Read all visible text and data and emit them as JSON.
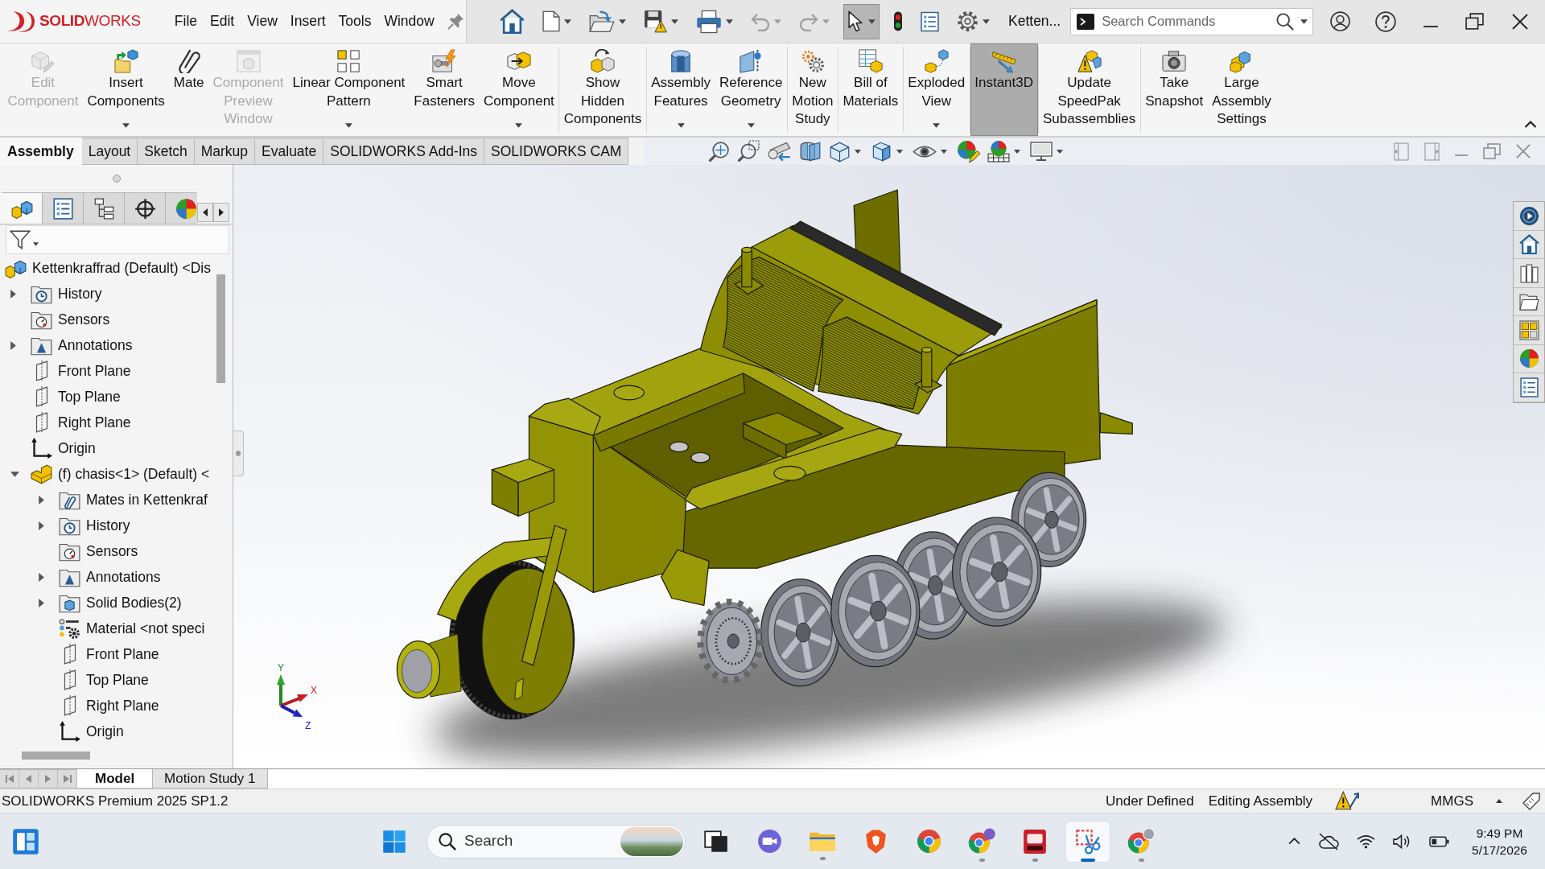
{
  "title_bar": {
    "logo": "**SOLID**WORKS",
    "menus": [
      "File",
      "Edit",
      "View",
      "Insert",
      "Tools",
      "Window"
    ],
    "quick_access": [
      {
        "kind": "home",
        "dropdown": false,
        "disabled": false,
        "selected": false
      },
      {
        "kind": "new",
        "dropdown": true,
        "disabled": false,
        "selected": false
      },
      {
        "kind": "open",
        "dropdown": true,
        "disabled": false,
        "selected": false
      },
      {
        "kind": "save",
        "dropdown": true,
        "disabled": false,
        "selected": false
      },
      {
        "kind": "print",
        "dropdown": true,
        "disabled": false,
        "selected": false
      },
      {
        "kind": "undo",
        "dropdown": true,
        "disabled": true,
        "selected": false
      },
      {
        "kind": "redo",
        "dropdown": true,
        "disabled": true,
        "selected": false
      },
      {
        "kind": "select",
        "dropdown": true,
        "disabled": false,
        "selected": true
      },
      {
        "kind": "rebuild",
        "dropdown": false,
        "disabled": false,
        "selected": false
      },
      {
        "kind": "file-properties",
        "dropdown": false,
        "disabled": false,
        "selected": false
      },
      {
        "kind": "options",
        "dropdown": true,
        "disabled": false,
        "selected": false
      }
    ],
    "document_title": "Ketten...",
    "search": {
      "placeholder": "Search Commands"
    }
  },
  "ribbon": {
    "groups": [
      {
        "items": [
          {
            "kind": "edit-component",
            "lines": [
              "Edit",
              "Component"
            ],
            "disabled": true,
            "dropdown": false,
            "on": false
          },
          {
            "kind": "insert-components",
            "lines": [
              "Insert",
              "Components"
            ],
            "disabled": false,
            "dropdown": true,
            "on": false
          },
          {
            "kind": "mate",
            "lines": [
              "Mate"
            ],
            "disabled": false,
            "dropdown": false,
            "on": false
          },
          {
            "kind": "preview-window",
            "lines": [
              "Component",
              "Preview",
              "Window"
            ],
            "disabled": true,
            "dropdown": false,
            "on": false
          },
          {
            "kind": "linear-pattern",
            "lines": [
              "Linear Component",
              "Pattern"
            ],
            "disabled": false,
            "dropdown": true,
            "on": false
          },
          {
            "kind": "smart-fasteners",
            "lines": [
              "Smart",
              "Fasteners"
            ],
            "disabled": false,
            "dropdown": false,
            "on": false
          },
          {
            "kind": "move-component",
            "lines": [
              "Move",
              "Component"
            ],
            "disabled": false,
            "dropdown": true,
            "on": false
          }
        ]
      },
      {
        "items": [
          {
            "kind": "show-hidden",
            "lines": [
              "Show",
              "Hidden",
              "Components"
            ],
            "disabled": false,
            "dropdown": false,
            "on": false
          }
        ]
      },
      {
        "items": [
          {
            "kind": "assembly-features",
            "lines": [
              "Assembly",
              "Features"
            ],
            "disabled": false,
            "dropdown": true,
            "on": false
          },
          {
            "kind": "reference-geometry",
            "lines": [
              "Reference",
              "Geometry"
            ],
            "disabled": false,
            "dropdown": true,
            "on": false
          }
        ]
      },
      {
        "items": [
          {
            "kind": "motion-study",
            "lines": [
              "New",
              "Motion",
              "Study"
            ],
            "disabled": false,
            "dropdown": false,
            "on": false
          }
        ]
      },
      {
        "items": [
          {
            "kind": "bill-of-materials",
            "lines": [
              "Bill of",
              "Materials"
            ],
            "disabled": false,
            "dropdown": false,
            "on": false
          }
        ]
      },
      {
        "items": [
          {
            "kind": "exploded-view",
            "lines": [
              "Exploded",
              "View"
            ],
            "disabled": false,
            "dropdown": true,
            "on": false
          }
        ]
      },
      {
        "items": [
          {
            "kind": "instant3d",
            "lines": [
              "Instant3D"
            ],
            "disabled": false,
            "dropdown": false,
            "on": true
          }
        ]
      },
      {
        "items": [
          {
            "kind": "speedpak",
            "lines": [
              "Update",
              "SpeedPak",
              "Subassemblies"
            ],
            "disabled": false,
            "dropdown": false,
            "on": false
          }
        ]
      },
      {
        "items": [
          {
            "kind": "snapshot",
            "lines": [
              "Take",
              "Snapshot"
            ],
            "disabled": false,
            "dropdown": false,
            "on": false
          },
          {
            "kind": "large-assembly",
            "lines": [
              "Large",
              "Assembly",
              "Settings"
            ],
            "disabled": false,
            "dropdown": false,
            "on": false
          }
        ]
      }
    ]
  },
  "command_tabs": [
    {
      "label": "Assembly",
      "selected": true
    },
    {
      "label": "Layout",
      "selected": false
    },
    {
      "label": "Sketch",
      "selected": false
    },
    {
      "label": "Markup",
      "selected": false
    },
    {
      "label": "Evaluate",
      "selected": false
    },
    {
      "label": "SOLIDWORKS Add-Ins",
      "selected": false
    },
    {
      "label": "SOLIDWORKS CAM",
      "selected": false
    }
  ],
  "feature_tree": {
    "panel_tabs": [
      {
        "kind": "feature-manager",
        "selected": true
      },
      {
        "kind": "property-manager",
        "selected": false
      },
      {
        "kind": "configuration-manager",
        "selected": false
      },
      {
        "kind": "dimxpert-manager",
        "selected": false
      },
      {
        "kind": "display-manager",
        "selected": false
      }
    ],
    "items": [
      {
        "label": "Kettenkraffrad (Default) <Dis",
        "kind": "assembly",
        "children": [
          {
            "label": "History",
            "kind": "history",
            "expanded": false
          },
          {
            "label": "Sensors",
            "kind": "sensors"
          },
          {
            "label": "Annotations",
            "kind": "annotations",
            "expanded": false
          },
          {
            "label": "Front Plane",
            "kind": "plane"
          },
          {
            "label": "Top Plane",
            "kind": "plane"
          },
          {
            "label": "Right Plane",
            "kind": "plane"
          },
          {
            "label": "Origin",
            "kind": "origin"
          },
          {
            "label": "(f) chasis<1> (Default) <",
            "kind": "part",
            "expanded": true,
            "children": [
              {
                "label": "Mates in Kettenkraf",
                "kind": "mates",
                "expanded": false
              },
              {
                "label": "History",
                "kind": "history",
                "expanded": false
              },
              {
                "label": "Sensors",
                "kind": "sensors"
              },
              {
                "label": "Annotations",
                "kind": "annotations",
                "expanded": false
              },
              {
                "label": "Solid Bodies(2)",
                "kind": "solid-bodies",
                "expanded": false
              },
              {
                "label": "Material <not speci",
                "kind": "material"
              },
              {
                "label": "Front Plane",
                "kind": "plane"
              },
              {
                "label": "Top Plane",
                "kind": "plane"
              },
              {
                "label": "Right Plane",
                "kind": "plane"
              },
              {
                "label": "Origin",
                "kind": "origin"
              }
            ]
          }
        ]
      }
    ]
  },
  "triad": {
    "x": "X",
    "y": "Y",
    "z": "Z"
  },
  "model_tabs": [
    {
      "label": "Model",
      "selected": true
    },
    {
      "label": "Motion Study 1",
      "selected": false
    }
  ],
  "status_bar": {
    "product": "SOLIDWORKS Premium 2025 SP1.2",
    "definition": "Under Defined",
    "mode": "Editing Assembly",
    "units": "MMGS"
  },
  "taskbar": {
    "search": {
      "placeholder": "Search"
    },
    "apps": [
      {
        "kind": "task-view",
        "running": false,
        "selected": false
      },
      {
        "kind": "video-call",
        "running": false,
        "selected": false
      },
      {
        "kind": "file-explorer",
        "running": true,
        "selected": false
      },
      {
        "kind": "shield-browser",
        "running": false,
        "selected": false
      },
      {
        "kind": "browser",
        "running": false,
        "selected": false
      },
      {
        "kind": "browser-profile",
        "running": true,
        "selected": false
      },
      {
        "kind": "cad-app",
        "running": true,
        "selected": false
      },
      {
        "kind": "snipping-tool",
        "running": true,
        "selected": true
      },
      {
        "kind": "browser-badged",
        "running": true,
        "selected": false
      }
    ],
    "time": "9:49 PM",
    "date": "5/17/2026"
  }
}
